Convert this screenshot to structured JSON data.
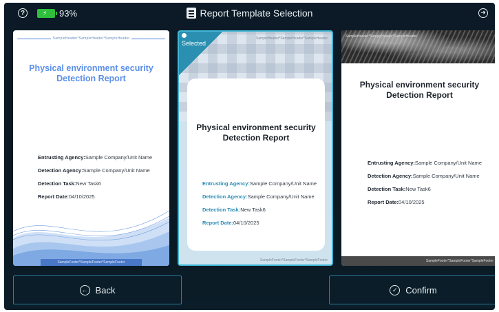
{
  "status_bar": {
    "battery_percent": "93%",
    "title": "Report Template Selection",
    "icons": [
      "help-icon",
      "battery-icon",
      "report-icon",
      "exit-icon"
    ]
  },
  "templates": [
    {
      "header_text": "SampleHeader*SampleHeader*SampleHeader",
      "title_line1": "Physical environment security",
      "title_line2": "Detection Report",
      "entrusting_label": "Entrusting Agency:",
      "entrusting_value": "Sample Company/Unit Name",
      "agency_label": "Detection Agency:",
      "agency_value": "Sample Company/Unit Name",
      "task_label": "Detection Task:",
      "task_value": "New Task6",
      "date_label": "Report Date:",
      "date_value": "04/10/2025",
      "footer_text": "SampleFooter*SampleFooter*SampleFooter"
    },
    {
      "selected_label": "Selected",
      "header_text": "SampleHeader*SampleHeader*SampleHeader",
      "title_line1": "Physical environment security",
      "title_line2": "Detection Report",
      "entrusting_label": "Entrusting Agency:",
      "entrusting_value": "Sample Company/Unit Name",
      "agency_label": "Detection Agency:",
      "agency_value": "Sample Company/Unit Name",
      "task_label": "Detection Task:",
      "task_value": "New Task6",
      "date_label": "Report Date:",
      "date_value": "04/10/2025",
      "footer_text": "SampleFooter*SampleFooter*SampleFooter"
    },
    {
      "header_text": "SampleHeader*SampleHeader*SampleHeader",
      "title_line1": "Physical environment security",
      "title_line2": "Detection Report",
      "entrusting_label": "Entrusting Agency:",
      "entrusting_value": "Sample Company/Unit Name",
      "agency_label": "Detection Agency:",
      "agency_value": "Sample Company/Unit Name",
      "task_label": "Detection Task:",
      "task_value": "New Task6",
      "date_label": "Report Date:",
      "date_value": "04/10/2025",
      "footer_text": "SampleFooter*SampleFooter*SampleFooter"
    }
  ],
  "buttons": {
    "back_label": "Back",
    "confirm_label": "Confirm"
  },
  "colors": {
    "background": "#0b1a26",
    "accent": "#41b6d6",
    "title_blue": "#5b8fe8",
    "battery": "#2fbf3c"
  }
}
